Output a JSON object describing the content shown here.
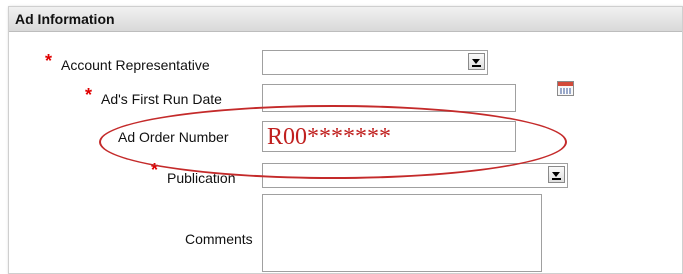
{
  "section": {
    "title": "Ad Information"
  },
  "fields": {
    "account_rep": {
      "label": "Account Representative",
      "required_mark": "*",
      "value": ""
    },
    "first_run_date": {
      "label": "Ad's First Run Date",
      "required_mark": "*",
      "value": ""
    },
    "order_number": {
      "label": "Ad Order Number",
      "value": "R00*******"
    },
    "publication": {
      "label": "Publication",
      "required_mark": "*",
      "value": ""
    },
    "comments": {
      "label": "Comments",
      "value": ""
    }
  },
  "icons": {
    "calendar": "calendar-icon",
    "dropdown": "chevron-down-icon"
  },
  "colors": {
    "required": "#e00000",
    "annotation": "#c42a2a",
    "order_value": "#c0201f"
  }
}
